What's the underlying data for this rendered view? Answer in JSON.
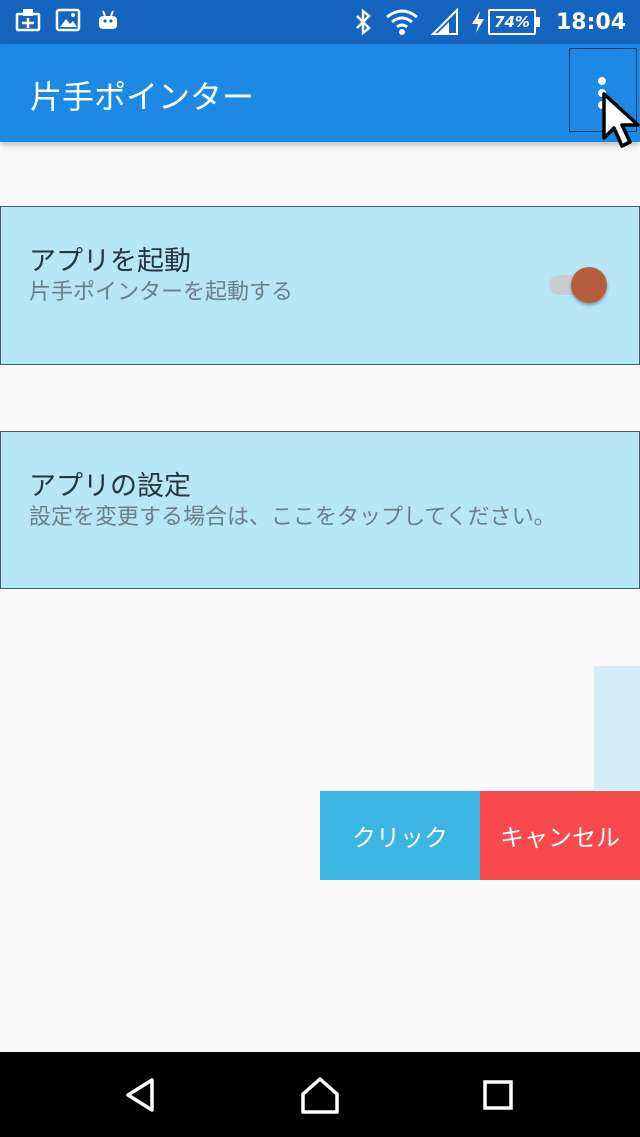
{
  "status_bar": {
    "icons_left": [
      "clipboard-icon",
      "gallery-icon",
      "android-icon"
    ],
    "icons_right": [
      "bluetooth-icon",
      "wifi-icon",
      "signal-icon",
      "charging-icon"
    ],
    "battery_percent": "74%",
    "time": "18:04"
  },
  "app_bar": {
    "title": "片手ポインター",
    "menu_icon": "more-vert-icon"
  },
  "cards": {
    "launch": {
      "title": "アプリを起動",
      "subtitle": "片手ポインターを起動する",
      "toggle_on": true
    },
    "settings": {
      "title": "アプリの設定",
      "subtitle": "設定を変更する場合は、ここをタップしてください。"
    }
  },
  "overlay": {
    "click_label": "クリック",
    "cancel_label": "キャンセル"
  },
  "nav": {
    "back_icon": "back-icon",
    "home_icon": "home-icon",
    "recents_icon": "recents-icon"
  },
  "colors": {
    "status_bar": "#1565c0",
    "app_bar": "#1e88e5",
    "card_bg": "#b7e6f4",
    "toggle_thumb": "#b85c3e",
    "click_button": "#3db5e2",
    "cancel_button": "#f8494d",
    "background": "#fafafa"
  }
}
